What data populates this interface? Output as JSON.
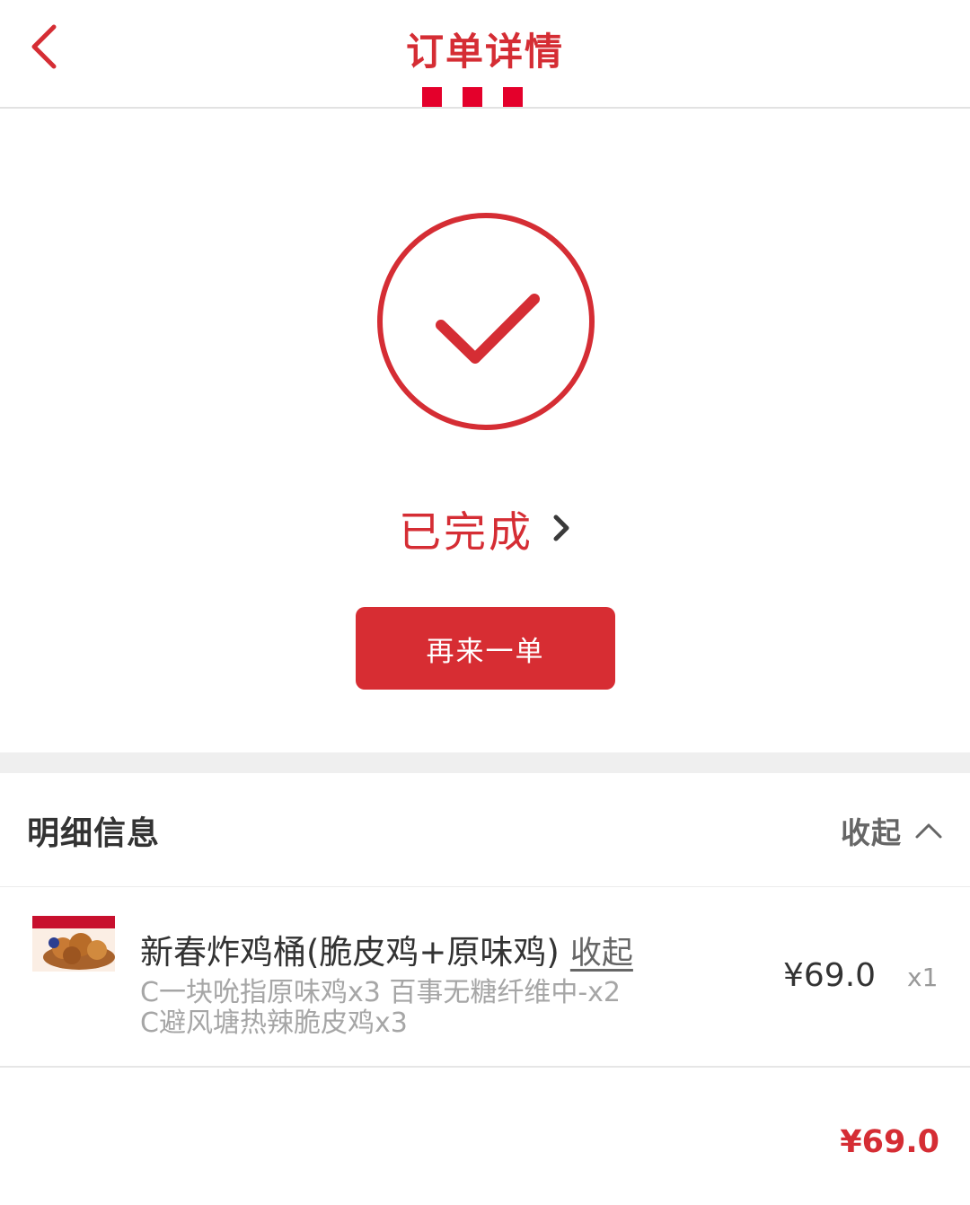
{
  "header": {
    "title": "订单详情"
  },
  "colors": {
    "brand_red": "#d52d34",
    "stripe_red": "#e4002b",
    "button_red": "#d72d33",
    "band_grey": "#efefef"
  },
  "icons": {
    "back": "chevron-left-icon",
    "status_check": "check-circle-icon",
    "status_more": "chevron-right-icon",
    "collapse": "chevron-up-icon"
  },
  "status": {
    "text": "已完成",
    "reorder_label": "再来一单"
  },
  "details": {
    "title": "明细信息",
    "collapse_label": "收起",
    "items": [
      {
        "name": "新春炸鸡桶(脆皮鸡+原味鸡)",
        "collapse_label": "收起",
        "sub_line_1": "C一块吮指原味鸡x3 百事无糖纤维中-x2",
        "sub_line_2": "C避风塘热辣脆皮鸡x3",
        "price": "¥69.0",
        "qty": "x1"
      }
    ]
  },
  "total": "¥69.0"
}
